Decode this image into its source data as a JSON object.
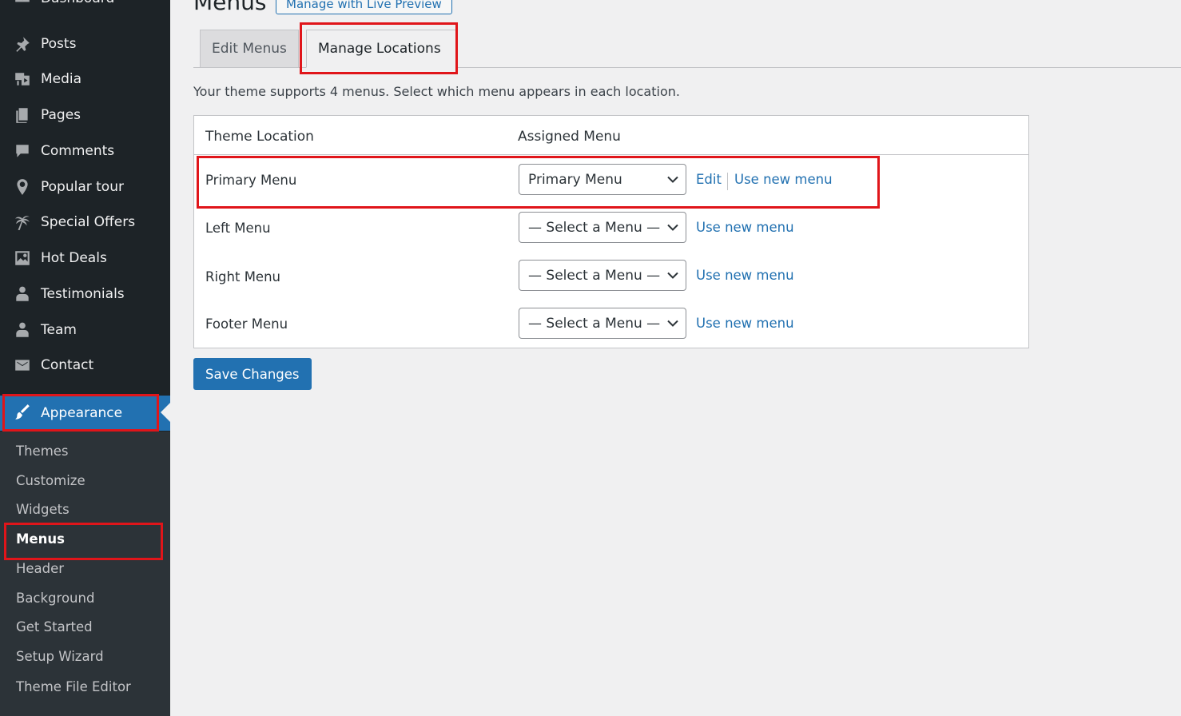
{
  "sidebar": {
    "top_partial": "Dashboard",
    "items": [
      {
        "label": "Posts",
        "icon": "pin-icon"
      },
      {
        "label": "Media",
        "icon": "media-icon"
      },
      {
        "label": "Pages",
        "icon": "pages-icon"
      },
      {
        "label": "Comments",
        "icon": "comments-icon"
      },
      {
        "label": "Popular tour",
        "icon": "location-icon"
      },
      {
        "label": "Special Offers",
        "icon": "palm-tree-icon"
      },
      {
        "label": "Hot Deals",
        "icon": "image-icon"
      },
      {
        "label": "Testimonials",
        "icon": "user-icon"
      },
      {
        "label": "Team",
        "icon": "user-icon"
      },
      {
        "label": "Contact",
        "icon": "envelope-icon"
      },
      {
        "label": "Appearance",
        "icon": "paintbrush-icon",
        "current": true
      }
    ],
    "submenu": [
      {
        "label": "Themes"
      },
      {
        "label": "Customize"
      },
      {
        "label": "Widgets"
      },
      {
        "label": "Menus",
        "current": true
      },
      {
        "label": "Header"
      },
      {
        "label": "Background"
      },
      {
        "label": "Get Started"
      },
      {
        "label": "Setup Wizard"
      },
      {
        "label": "Theme File Editor"
      }
    ]
  },
  "header": {
    "title": "Menus",
    "live_preview_label": "Manage with Live Preview"
  },
  "tabs": [
    {
      "label": "Edit Menus",
      "active": false
    },
    {
      "label": "Manage Locations",
      "active": true
    }
  ],
  "intro": "Your theme supports 4 menus. Select which menu appears in each location.",
  "table": {
    "headers": [
      "Theme Location",
      "Assigned Menu"
    ],
    "rows": [
      {
        "location": "Primary Menu",
        "selected": "Primary Menu",
        "edit_label": "Edit",
        "new_label": "Use new menu"
      },
      {
        "location": "Left Menu",
        "selected": "— Select a Menu —",
        "new_label": "Use new menu"
      },
      {
        "location": "Right Menu",
        "selected": "— Select a Menu —",
        "new_label": "Use new menu"
      },
      {
        "location": "Footer Menu",
        "selected": "— Select a Menu —",
        "new_label": "Use new menu"
      }
    ]
  },
  "save_label": "Save Changes",
  "colors": {
    "sidebar_bg": "#1d2327",
    "submenu_bg": "#2c3338",
    "accent": "#2271b1",
    "highlight": "#e0151a",
    "page_bg": "#f0f0f1"
  }
}
